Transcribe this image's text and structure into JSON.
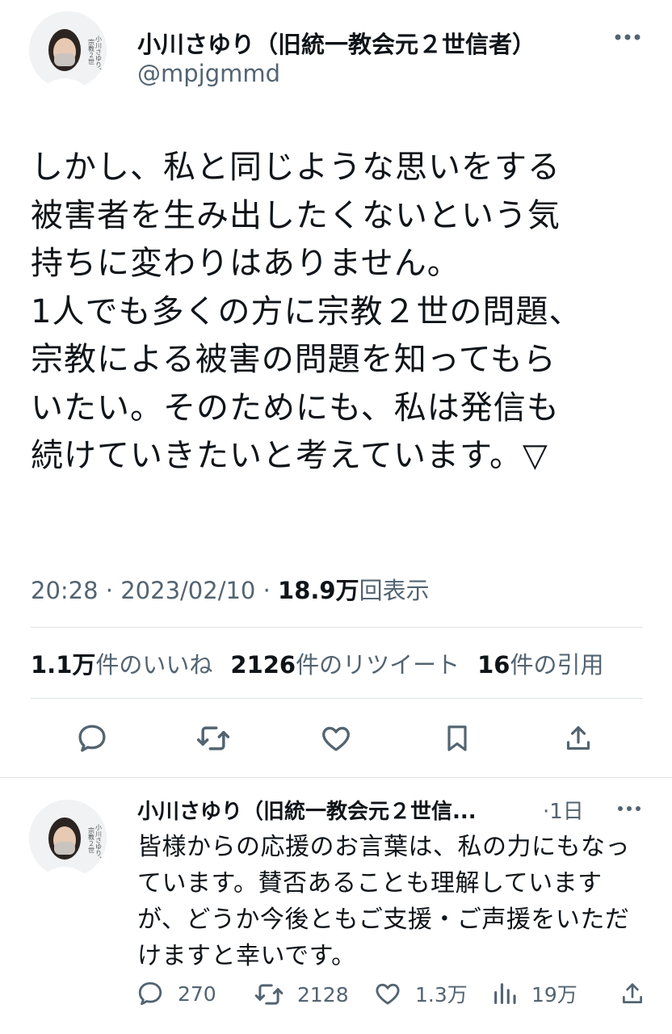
{
  "tweet": {
    "author": {
      "name": "小川さゆり（旧統一教会元２世信者）",
      "handle": "@mpjgmmd",
      "avatar_label_lines": [
        "小川さゆり、",
        "宗教２世"
      ]
    },
    "text_lines": [
      "しかし、私と同じような思いをする",
      "被害者を生み出したくないという気",
      "持ちに変わりはありません。",
      "1人でも多くの方に宗教２世の問題、",
      "宗教による被害の問題を知ってもら",
      "いたい。そのためにも、私は発信も",
      "続けていきたいと考えています。▽"
    ],
    "time": "20:28",
    "date": "2023/02/10",
    "views_value": "18.9万",
    "views_label": "回表示",
    "sep": "·",
    "stats": {
      "likes_value": "1.1万",
      "likes_label": "件のいいね",
      "retweets_value": "2126",
      "retweets_label": "件のリツイート",
      "quotes_value": "16",
      "quotes_label": "件の引用"
    },
    "actions": [
      "reply-icon",
      "retweet-icon",
      "like-icon",
      "bookmark-icon",
      "share-icon"
    ]
  },
  "reply": {
    "author": {
      "name": "小川さゆり（旧統一教会元２世信...",
      "time": "1日"
    },
    "text_lines": [
      "皆様からの応援のお言葉は、私の力にもなっ",
      "ています。賛否あることも理解しています",
      "が、どうか今後ともご支援・ご声援をいただ",
      "けますと幸いです。"
    ],
    "counts": {
      "replies": "270",
      "retweets": "2128",
      "likes": "1.3万",
      "views": "19万"
    }
  },
  "colors": {
    "text": "#0f1419",
    "secondary": "#536471",
    "divider": "#dfe3e6"
  }
}
